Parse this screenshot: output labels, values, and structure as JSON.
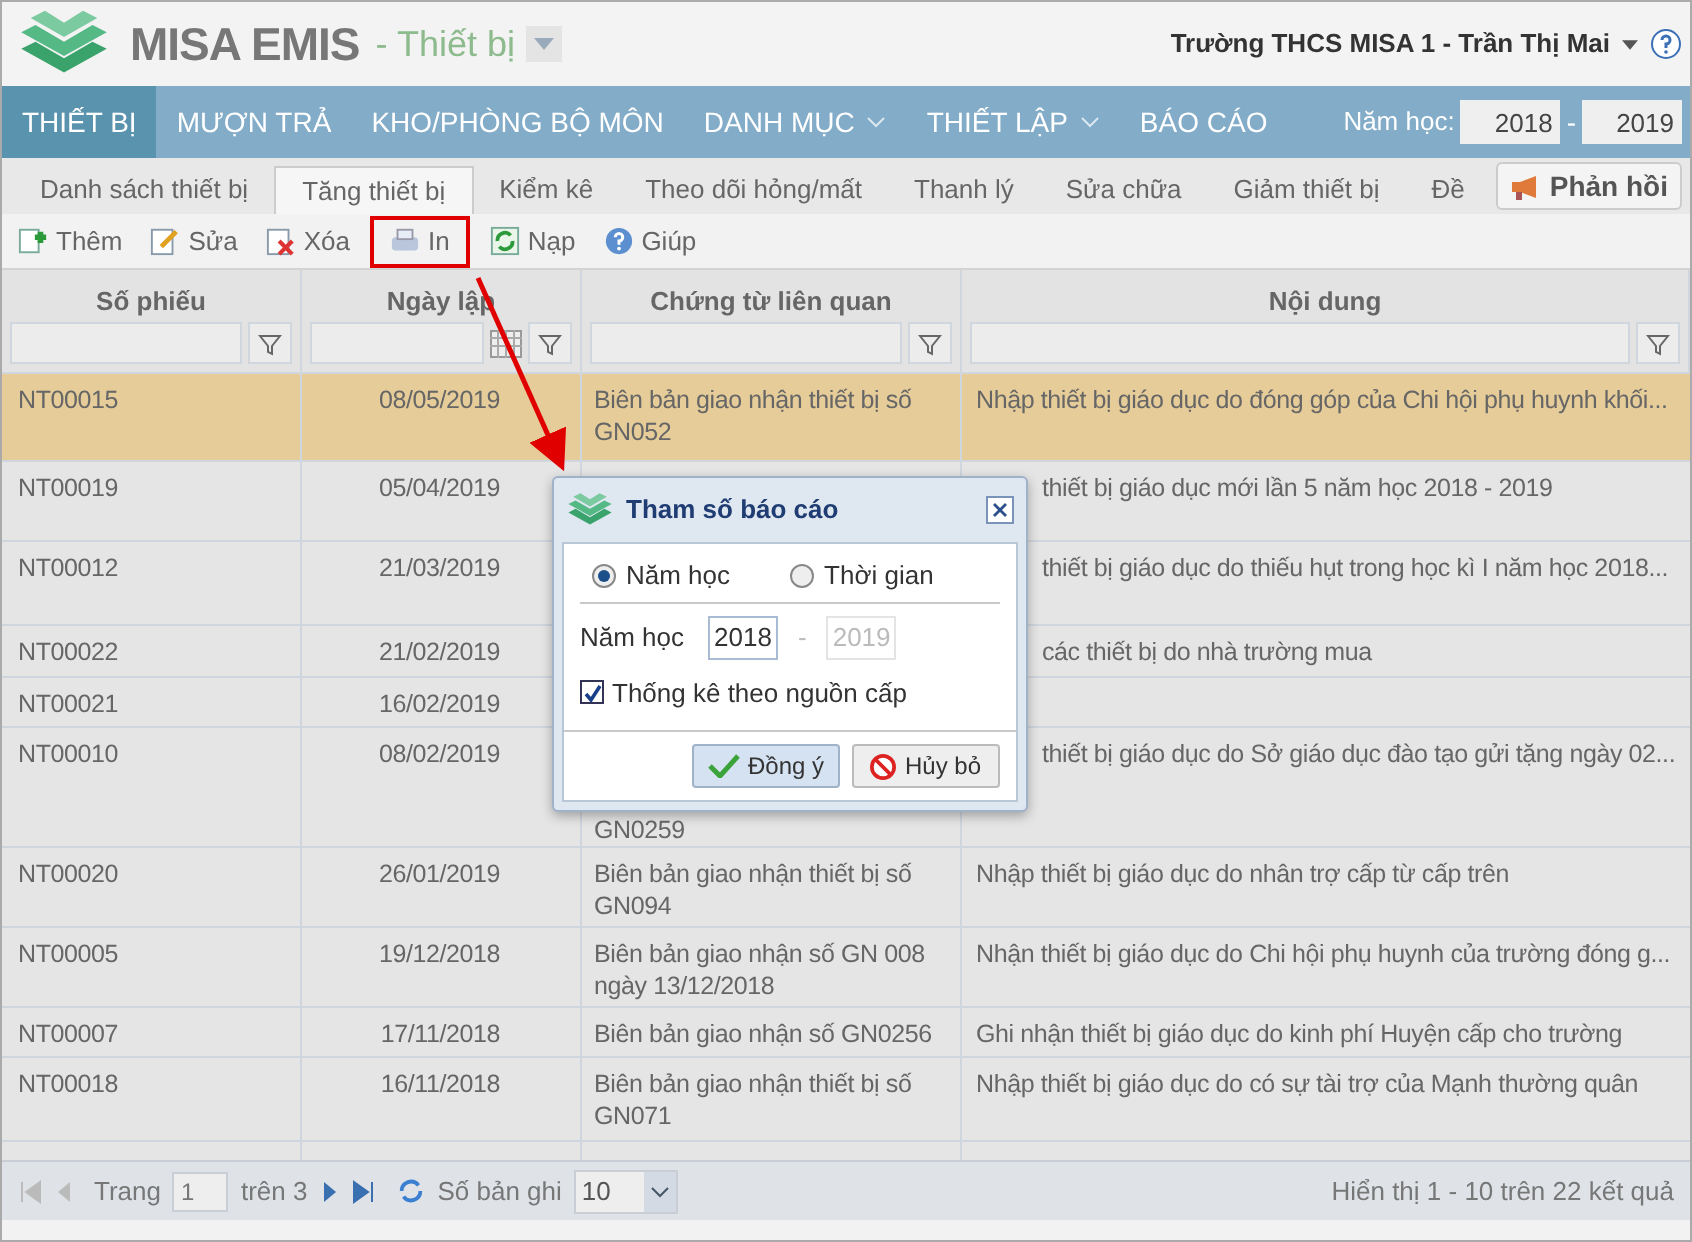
{
  "header": {
    "app_name": "MISA EMIS",
    "module": "- Thiết bị",
    "user": "Trường THCS MISA 1 - Trần Thị Mai"
  },
  "nav": {
    "items": [
      {
        "label": "THIẾT BỊ",
        "selected": true,
        "dropdown": false
      },
      {
        "label": "MƯỢN TRẢ",
        "selected": false,
        "dropdown": false
      },
      {
        "label": "KHO/PHÒNG BỘ MÔN",
        "selected": false,
        "dropdown": false
      },
      {
        "label": "DANH MỤC",
        "selected": false,
        "dropdown": true
      },
      {
        "label": "THIẾT LẬP",
        "selected": false,
        "dropdown": true
      },
      {
        "label": "BÁO CÁO",
        "selected": false,
        "dropdown": false
      }
    ],
    "year_label": "Năm học:",
    "year_from": "2018",
    "year_separator": "-",
    "year_to": "2019"
  },
  "tabs": [
    {
      "label": "Danh sách thiết bị",
      "selected": false
    },
    {
      "label": "Tăng thiết bị",
      "selected": true
    },
    {
      "label": "Kiểm kê",
      "selected": false
    },
    {
      "label": "Theo dõi hỏng/mất",
      "selected": false
    },
    {
      "label": "Thanh lý",
      "selected": false
    },
    {
      "label": "Sửa chữa",
      "selected": false
    },
    {
      "label": "Giảm thiết bị",
      "selected": false
    },
    {
      "label": "Đề",
      "selected": false
    }
  ],
  "feedback_button": "Phản hồi",
  "toolbar": [
    {
      "kind": "add",
      "label": "Thêm",
      "highlighted": false
    },
    {
      "kind": "edit",
      "label": "Sửa",
      "highlighted": false
    },
    {
      "kind": "delete",
      "label": "Xóa",
      "highlighted": false
    },
    {
      "kind": "print",
      "label": "In",
      "highlighted": true
    },
    {
      "kind": "reload",
      "label": "Nạp",
      "highlighted": false
    },
    {
      "kind": "help",
      "label": "Giúp",
      "highlighted": false
    }
  ],
  "table": {
    "columns": [
      "Số phiếu",
      "Ngày lập",
      "Chứng từ liên quan",
      "Nội dung"
    ],
    "rows": [
      {
        "id": "NT00015",
        "date": "08/05/2019",
        "document": "Biên bản giao nhận thiết bị số GN052",
        "content": "Nhập thiết bị giáo dục do đóng góp của Chi hội phụ huynh khối...",
        "selected": true,
        "covered": false
      },
      {
        "id": "NT00019",
        "date": "05/04/2019",
        "content": "thiết bị giáo dục mới lần 5 năm học 2018 - 2019",
        "selected": false,
        "covered": true
      },
      {
        "id": "NT00012",
        "date": "21/03/2019",
        "content": "thiết bị giáo dục do thiếu hụt trong học kì I năm học 2018...",
        "selected": false,
        "covered": true
      },
      {
        "id": "NT00022",
        "date": "21/02/2019",
        "content": "các thiết bị do nhà trường mua",
        "selected": false,
        "covered": true
      },
      {
        "id": "NT00021",
        "date": "16/02/2019",
        "selected": false
      },
      {
        "id": "NT00010",
        "date": "08/02/2019",
        "document": "GN0259",
        "content": "thiết bị giáo dục do Sở giáo dục đào tạo gửi tặng ngày 02...",
        "selected": false,
        "covered": true
      },
      {
        "id": "NT00020",
        "date": "26/01/2019",
        "document": "Biên bản giao nhận thiết bị số GN094",
        "content": "Nhập thiết bị giáo dục do nhân trợ cấp từ cấp trên",
        "selected": false,
        "covered": false
      },
      {
        "id": "NT00005",
        "date": "19/12/2018",
        "document": "Biên bản giao nhận số GN 008 ngày 13/12/2018",
        "content": "Nhận thiết bị giáo dục do Chi hội phụ huynh của trường đóng g...",
        "selected": false,
        "covered": false
      },
      {
        "id": "NT00007",
        "date": "17/11/2018",
        "document": "Biên bản giao nhận số GN0256",
        "content": "Ghi nhận thiết bị giáo dục do kinh phí Huyện cấp cho trường",
        "selected": false,
        "covered": false
      },
      {
        "id": "NT00018",
        "date": "16/11/2018",
        "document": "Biên bản giao nhận thiết bị số GN071",
        "content": "Nhập thiết bị giáo dục do có sự tài trợ của Mạnh thường quân",
        "selected": false,
        "covered": false
      }
    ]
  },
  "pager": {
    "page_label": "Trang",
    "page": "1",
    "of_pages": "trên 3",
    "size_label": "Số bản ghi",
    "size": "10",
    "summary": "Hiển thị 1 - 10 trên 22 kết quả"
  },
  "dialog": {
    "title": "Tham số báo cáo",
    "options": [
      {
        "label": "Năm học",
        "selected": true
      },
      {
        "label": "Thời gian",
        "selected": false
      }
    ],
    "year_label": "Năm học",
    "year_from": "2018",
    "year_separator": "-",
    "year_to": "2019",
    "year_to_disabled": true,
    "checkbox": {
      "label": "Thống kê theo nguồn cấp",
      "checked": true
    },
    "buttons": [
      {
        "kind": "ok",
        "label": "Đồng ý"
      },
      {
        "kind": "cancel",
        "label": "Hủy bỏ"
      }
    ]
  }
}
